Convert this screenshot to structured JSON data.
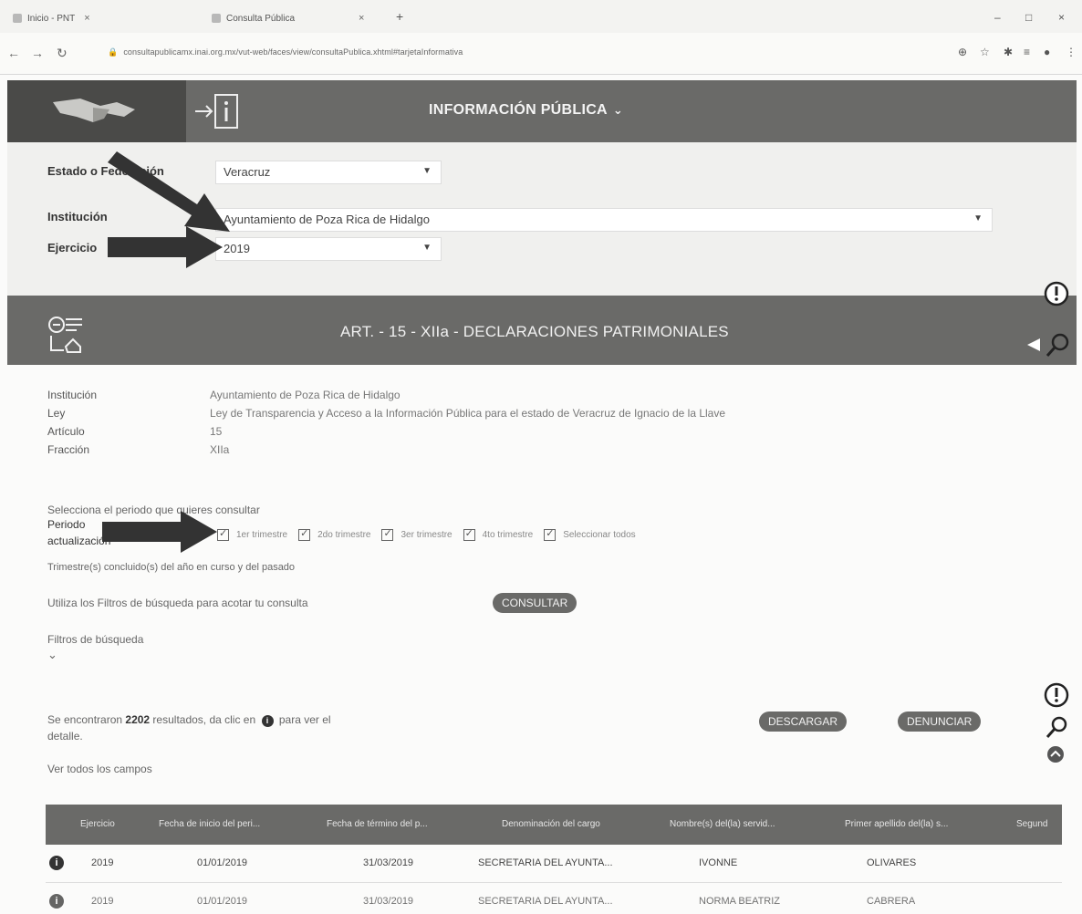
{
  "browser": {
    "tabs": [
      {
        "label": "Inicio - PNT"
      },
      {
        "label": "Consulta Pública"
      }
    ],
    "url": "consultapublicamx.inai.org.mx/vut-web/faces/view/consultaPublica.xhtml#tarjetaInformativa"
  },
  "header": {
    "title": "INFORMACIÓN PÚBLICA"
  },
  "form": {
    "estado_label": "Estado o Federación",
    "estado_value": "Veracruz",
    "institucion_label": "Institución",
    "institucion_value": "Ayuntamiento de Poza Rica de Hidalgo",
    "ejercicio_label": "Ejercicio",
    "ejercicio_value": "2019"
  },
  "section": {
    "title": "ART. - 15 - XIIa - DECLARACIONES PATRIMONIALES"
  },
  "details": {
    "institucion_label": "Institución",
    "institucion_value": "Ayuntamiento de Poza Rica de Hidalgo",
    "ley_label": "Ley",
    "ley_value": "Ley de Transparencia y Acceso a la Información Pública para el estado de Veracruz de Ignacio de la Llave",
    "articulo_label": "Artículo",
    "articulo_value": "15",
    "fraccion_label": "Fracción",
    "fraccion_value": "XIIa"
  },
  "period": {
    "prompt": "Selecciona el periodo que quieres consultar",
    "label_1": "Periodo",
    "label_2": "actualización",
    "options": [
      "1er trimestre",
      "2do trimestre",
      "3er trimestre",
      "4to trimestre",
      "Seleccionar todos"
    ],
    "note": "Trimestre(s) concluido(s) del año en curso y del pasado"
  },
  "filters": {
    "hint": "Utiliza los Filtros de búsqueda para acotar tu consulta",
    "consultar": "CONSULTAR",
    "title": "Filtros de búsqueda"
  },
  "results": {
    "text_prefix": "Se encontraron ",
    "count": "2202",
    "text_suffix": " resultados, da clic en",
    "text_suffix_2": "para ver el",
    "text_line2": "detalle.",
    "descargar": "DESCARGAR",
    "denunciar": "DENUNCIAR",
    "ver_todos": "Ver todos los campos"
  },
  "table": {
    "columns": [
      "Ejercicio",
      "Fecha de inicio del peri...",
      "Fecha de término del p...",
      "Denominación del cargo",
      "Nombre(s) del(la) servid...",
      "Primer apellido del(la) s...",
      "Segund"
    ],
    "rows": [
      [
        "2019",
        "01/01/2019",
        "31/03/2019",
        "SECRETARIA DEL AYUNTA...",
        "IVONNE",
        "OLIVARES"
      ],
      [
        "2019",
        "01/01/2019",
        "31/03/2019",
        "SECRETARIA DEL AYUNTA...",
        "NORMA BEATRIZ",
        "CABRERA"
      ]
    ]
  }
}
